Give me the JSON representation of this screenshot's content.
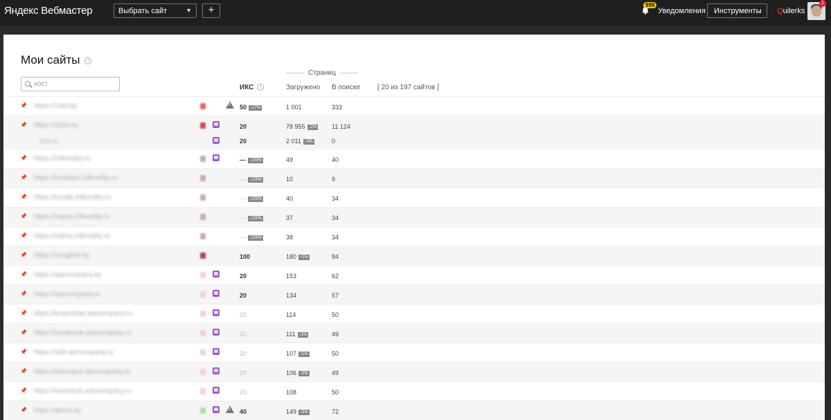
{
  "header": {
    "logo_brand": "Яндекс",
    "logo_product": "Вебмастер",
    "site_select_label": "Выбрать сайт",
    "add_label": "+",
    "notifications_badge": "999",
    "notifications_label": "Уведомления",
    "tools_label": "Инструменты",
    "user_first": "Q",
    "user_rest": "uilerks",
    "avatar_badge": "1"
  },
  "main": {
    "title": "Мои сайты",
    "info_icon": "i",
    "search_placeholder": "хост",
    "col_group": "Страниц",
    "col_iks": "ИКС",
    "col_loaded": "Загружено",
    "col_in_search": "В поиске",
    "site_count": "[ 20 из 197 сайтов ]"
  },
  "colors": {
    "topbar": "#1f1f1f",
    "accent_badge": "#ffcc00",
    "purple_icon": "#9b59d0"
  },
  "rows": [
    {
      "host": "https://1dol.by",
      "dot": "#f06060",
      "purple": false,
      "warn": true,
      "iks": "50",
      "iks_badge": "↓17%",
      "iks_dim": false,
      "loaded": "1 001",
      "loaded_badge": "",
      "in_search": "333",
      "alt": false,
      "sub": false
    },
    {
      "host": "https://220v.by",
      "dot": "#d04858",
      "purple": true,
      "warn": false,
      "iks": "20",
      "iks_badge": "",
      "iks_dim": false,
      "loaded": "78 955",
      "loaded_badge": "↓2%",
      "in_search": "11 124",
      "alt": true,
      "sub": false
    },
    {
      "host": "220v.by",
      "dot": "",
      "purple": true,
      "warn": false,
      "iks": "20",
      "iks_badge": "",
      "iks_dim": false,
      "loaded": "2 011",
      "loaded_badge": "↓4%",
      "in_search": "0",
      "alt": true,
      "sub": true
    },
    {
      "host": "https://24kredity.ru",
      "dot": "#c8a8c8",
      "purple": true,
      "warn": false,
      "iks": "—",
      "iks_badge": "↓100%",
      "iks_dim": false,
      "loaded": "49",
      "loaded_badge": "",
      "in_search": "40",
      "alt": false,
      "sub": false
    },
    {
      "host": "https://lombard.24kredity.ru",
      "dot": "#c8a8c8",
      "purple": false,
      "warn": false,
      "iks": "—",
      "iks_badge": "↓100%",
      "iks_dim": true,
      "loaded": "10",
      "loaded_badge": "",
      "in_search": "9",
      "alt": true,
      "sub": false
    },
    {
      "host": "https://ssuda.24kredity.ru",
      "dot": "#c8a8c8",
      "purple": false,
      "warn": false,
      "iks": "—",
      "iks_badge": "↓100%",
      "iks_dim": true,
      "loaded": "40",
      "loaded_badge": "",
      "in_search": "34",
      "alt": false,
      "sub": false
    },
    {
      "host": "https://zajmy.24kredity.ru",
      "dot": "#c8a8c8",
      "purple": false,
      "warn": false,
      "iks": "—",
      "iks_badge": "↓100%",
      "iks_dim": true,
      "loaded": "37",
      "loaded_badge": "",
      "in_search": "34",
      "alt": true,
      "sub": false
    },
    {
      "host": "https://zaimy.24kredity.ru",
      "dot": "#c8a8c8",
      "purple": false,
      "warn": false,
      "iks": "—",
      "iks_badge": "↓100%",
      "iks_dim": true,
      "loaded": "38",
      "loaded_badge": "",
      "in_search": "34",
      "alt": false,
      "sub": false
    },
    {
      "host": "https://2english.by",
      "dot": "#b04060",
      "purple": false,
      "warn": false,
      "iks": "100",
      "iks_badge": "",
      "iks_dim": false,
      "loaded": "180",
      "loaded_badge": "↑1%",
      "in_search": "84",
      "alt": true,
      "sub": false
    },
    {
      "host": "https://aarcompany.by",
      "dot": "#f4d0d8",
      "purple": true,
      "warn": false,
      "iks": "20",
      "iks_badge": "",
      "iks_dim": false,
      "loaded": "153",
      "loaded_badge": "",
      "in_search": "62",
      "alt": false,
      "sub": false
    },
    {
      "host": "https://aarcompany.ru",
      "dot": "#f4d0d8",
      "purple": true,
      "warn": false,
      "iks": "20",
      "iks_badge": "",
      "iks_dim": false,
      "loaded": "134",
      "loaded_badge": "",
      "in_search": "57",
      "alt": true,
      "sub": false
    },
    {
      "host": "https://krasnodar.aarcompany.ru",
      "dot": "#f4d0d8",
      "purple": true,
      "warn": false,
      "iks": "20",
      "iks_badge": "",
      "iks_dim": true,
      "loaded": "114",
      "loaded_badge": "",
      "in_search": "50",
      "alt": false,
      "sub": false
    },
    {
      "host": "https://smolensk.aarcompany.ru",
      "dot": "#f4d0d8",
      "purple": true,
      "warn": false,
      "iks": "20",
      "iks_badge": "",
      "iks_dim": true,
      "loaded": "111",
      "loaded_badge": "↓1%",
      "in_search": "49",
      "alt": true,
      "sub": false
    },
    {
      "host": "https://spb.aarcompany.ru",
      "dot": "#f4d0d8",
      "purple": true,
      "warn": false,
      "iks": "20",
      "iks_badge": "",
      "iks_dim": true,
      "loaded": "107",
      "loaded_badge": "↑1%",
      "in_search": "50",
      "alt": false,
      "sub": false
    },
    {
      "host": "https://stavropol.aarcompany.ru",
      "dot": "#f4d0d8",
      "purple": true,
      "warn": false,
      "iks": "20",
      "iks_badge": "",
      "iks_dim": true,
      "loaded": "106",
      "loaded_badge": "↑2%",
      "in_search": "49",
      "alt": true,
      "sub": false
    },
    {
      "host": "https://voronezh.aarcompany.ru",
      "dot": "#f4d0d8",
      "purple": true,
      "warn": false,
      "iks": "20",
      "iks_badge": "",
      "iks_dim": true,
      "loaded": "108",
      "loaded_badge": "",
      "in_search": "50",
      "alt": false,
      "sub": false
    },
    {
      "host": "https://abvet.by",
      "dot": "#a8e0a0",
      "purple": true,
      "warn": true,
      "iks": "40",
      "iks_badge": "",
      "iks_dim": false,
      "loaded": "149",
      "loaded_badge": "↓3%",
      "in_search": "72",
      "alt": true,
      "sub": false
    }
  ]
}
